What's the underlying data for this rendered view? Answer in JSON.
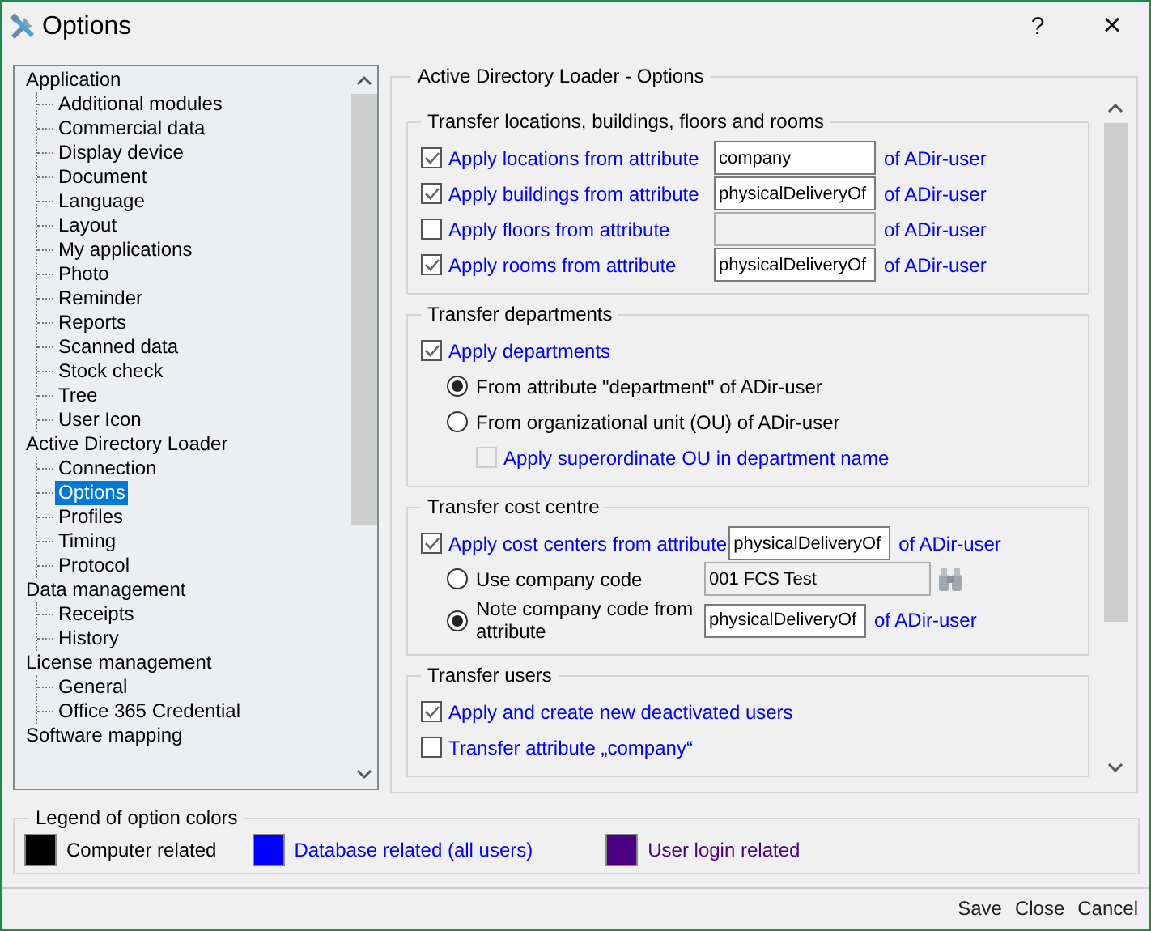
{
  "window": {
    "title": "Options",
    "help": "?",
    "close": "×"
  },
  "tree": {
    "items": [
      {
        "label": "Application",
        "selected": false,
        "children": [
          {
            "label": "Additional modules",
            "selected": false
          },
          {
            "label": "Commercial data",
            "selected": false
          },
          {
            "label": "Display device",
            "selected": false
          },
          {
            "label": "Document",
            "selected": false
          },
          {
            "label": "Language",
            "selected": false
          },
          {
            "label": "Layout",
            "selected": false
          },
          {
            "label": "My applications",
            "selected": false
          },
          {
            "label": "Photo",
            "selected": false
          },
          {
            "label": "Reminder",
            "selected": false
          },
          {
            "label": "Reports",
            "selected": false
          },
          {
            "label": "Scanned data",
            "selected": false
          },
          {
            "label": "Stock check",
            "selected": false
          },
          {
            "label": "Tree",
            "selected": false
          },
          {
            "label": "User Icon",
            "selected": false
          }
        ]
      },
      {
        "label": "Active Directory Loader",
        "selected": false,
        "children": [
          {
            "label": "Connection",
            "selected": false
          },
          {
            "label": "Options",
            "selected": true
          },
          {
            "label": "Profiles",
            "selected": false
          },
          {
            "label": "Timing",
            "selected": false
          },
          {
            "label": "Protocol",
            "selected": false
          }
        ]
      },
      {
        "label": "Data management",
        "selected": false,
        "children": [
          {
            "label": "Receipts",
            "selected": false
          },
          {
            "label": "History",
            "selected": false
          }
        ]
      },
      {
        "label": "License management",
        "selected": false,
        "children": [
          {
            "label": "General",
            "selected": false
          },
          {
            "label": "Office 365 Credential",
            "selected": false
          }
        ]
      },
      {
        "label": "Software mapping",
        "selected": false
      }
    ]
  },
  "panel": {
    "title": "Active Directory Loader - Options",
    "sections": [
      {
        "title": "Transfer locations, buildings, floors and rooms",
        "rows": [
          {
            "kind": "check_field",
            "label": "Apply locations from attribute",
            "color": "#0000ff",
            "checked": true,
            "field": {
              "value": "company",
              "disabled": false
            },
            "suffix": "of ADir-user"
          },
          {
            "kind": "check_field",
            "label": "Apply buildings from attribute",
            "color": "#0000ff",
            "checked": true,
            "field": {
              "value": "physicalDeliveryOf",
              "disabled": false
            },
            "suffix": "of ADir-user"
          },
          {
            "kind": "check_field",
            "label": "Apply floors from attribute",
            "color": "#0000ff",
            "checked": false,
            "field": {
              "disabled": true
            },
            "suffix": "of ADir-user"
          },
          {
            "kind": "check_field",
            "label": "Apply rooms from attribute",
            "color": "#0000ff",
            "checked": true,
            "field": {
              "value": "physicalDeliveryOf",
              "disabled": false
            },
            "suffix": "of ADir-user"
          }
        ]
      },
      {
        "title": "Transfer departments",
        "rows": [
          {
            "kind": "check",
            "label": "Apply departments",
            "color": "#0000ff",
            "checked": true,
            "disabled": false
          },
          {
            "kind": "radio",
            "label": "From attribute \"department\" of ADir-user",
            "color": "#000000",
            "selected": true
          },
          {
            "kind": "radio",
            "label": "From organizational unit (OU) of ADir-user",
            "color": "#000000",
            "selected": false
          },
          {
            "kind": "sub_check",
            "label": "Apply superordinate OU in department name",
            "color": "#0000ff",
            "checked": false,
            "disabled": true
          }
        ]
      },
      {
        "title": "Transfer cost centre",
        "rows": [
          {
            "kind": "check_field",
            "label": "Apply cost centers from attribute",
            "color": "#0000ff",
            "checked": true,
            "field": {
              "value": "physicalDeliveryOf",
              "disabled": false
            },
            "suffix": "of ADir-user"
          },
          {
            "kind": "radio_field",
            "label": "Use company code",
            "color": "#000000",
            "selected": false,
            "field": {
              "value": "001 FCS Test",
              "disabled": true
            },
            "lookup_button": true
          },
          {
            "kind": "radio_field",
            "label": "Note company code from attribute",
            "color": "#000000",
            "selected": true,
            "field": {
              "value": "physicalDeliveryOf",
              "disabled": false
            },
            "suffix": "of ADir-user"
          }
        ]
      },
      {
        "title": "Transfer users",
        "rows": [
          {
            "kind": "check",
            "label": "Apply and create new deactivated users",
            "color": "#0000ff",
            "checked": true,
            "disabled": false
          },
          {
            "kind": "check",
            "label": "Transfer attribute „company“",
            "color": "#0000ff",
            "checked": false,
            "disabled": false
          }
        ]
      }
    ]
  },
  "legend": {
    "title": "Legend of option colors",
    "items": [
      {
        "label": "Computer related",
        "color": "#000000"
      },
      {
        "label": "Database related (all users)",
        "color": "#0000ff"
      },
      {
        "label": "User login related",
        "color": "#4b0082"
      }
    ]
  },
  "buttons": [
    "Save",
    "Close",
    "Cancel"
  ]
}
